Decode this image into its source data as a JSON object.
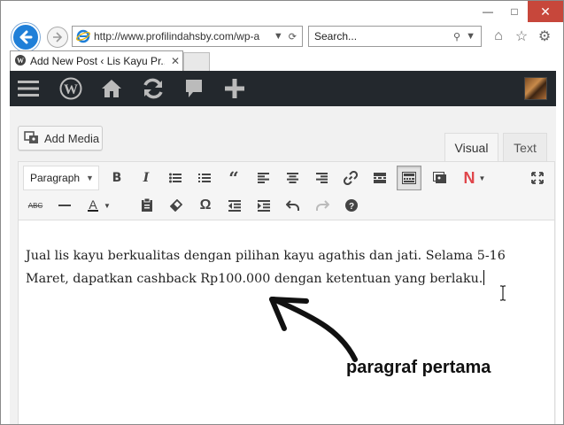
{
  "browser": {
    "address_url": "http://www.profilindahsby.com/wp-a",
    "search_placeholder": "Search...",
    "tab_title": "Add New Post ‹ Lis Kayu Pr...",
    "window_controls": [
      "minimize-icon",
      "maximize-icon",
      "close-icon"
    ],
    "toolbar_icons": [
      "home-icon",
      "star-icon",
      "gear-icon"
    ]
  },
  "admin_bar": {
    "icons": [
      "menu-icon",
      "wordpress-icon",
      "home-icon",
      "refresh-icon",
      "comment-icon",
      "plus-icon"
    ],
    "bg_color": "#23282d"
  },
  "editor": {
    "add_media_label": "Add Media",
    "visual_tab": "Visual",
    "text_tab": "Text",
    "format_select": "Paragraph",
    "row1_icons": [
      "bold-icon",
      "italic-icon",
      "bullet-list-icon",
      "numbered-list-icon",
      "blockquote-icon",
      "align-left-icon",
      "align-center-icon",
      "align-right-icon",
      "link-icon",
      "read-more-icon",
      "toolbar-toggle-icon",
      "media-icon",
      "n-plugin-icon",
      "fullscreen-icon"
    ],
    "row2_icons": [
      "strikethrough-icon",
      "horizontal-line-icon",
      "text-color-icon",
      "paste-text-icon",
      "clear-format-icon",
      "special-char-icon",
      "outdent-icon",
      "indent-icon",
      "undo-icon",
      "redo-icon",
      "help-icon"
    ],
    "strike_label": "ABC",
    "text_color_letter": "A",
    "n_letter": "N",
    "content_line1": "Jual lis kayu berkualitas dengan pilihan kayu agathis dan jati. Selama 5-16",
    "content_line2": "Maret, dapatkan cashback Rp100.000 dengan ketentuan yang berlaku."
  },
  "annotation": {
    "label": "paragraf pertama"
  },
  "colors": {
    "ie_blue": "#1f7fd8",
    "close_red": "#c7473b",
    "n_red": "#e0464b"
  }
}
